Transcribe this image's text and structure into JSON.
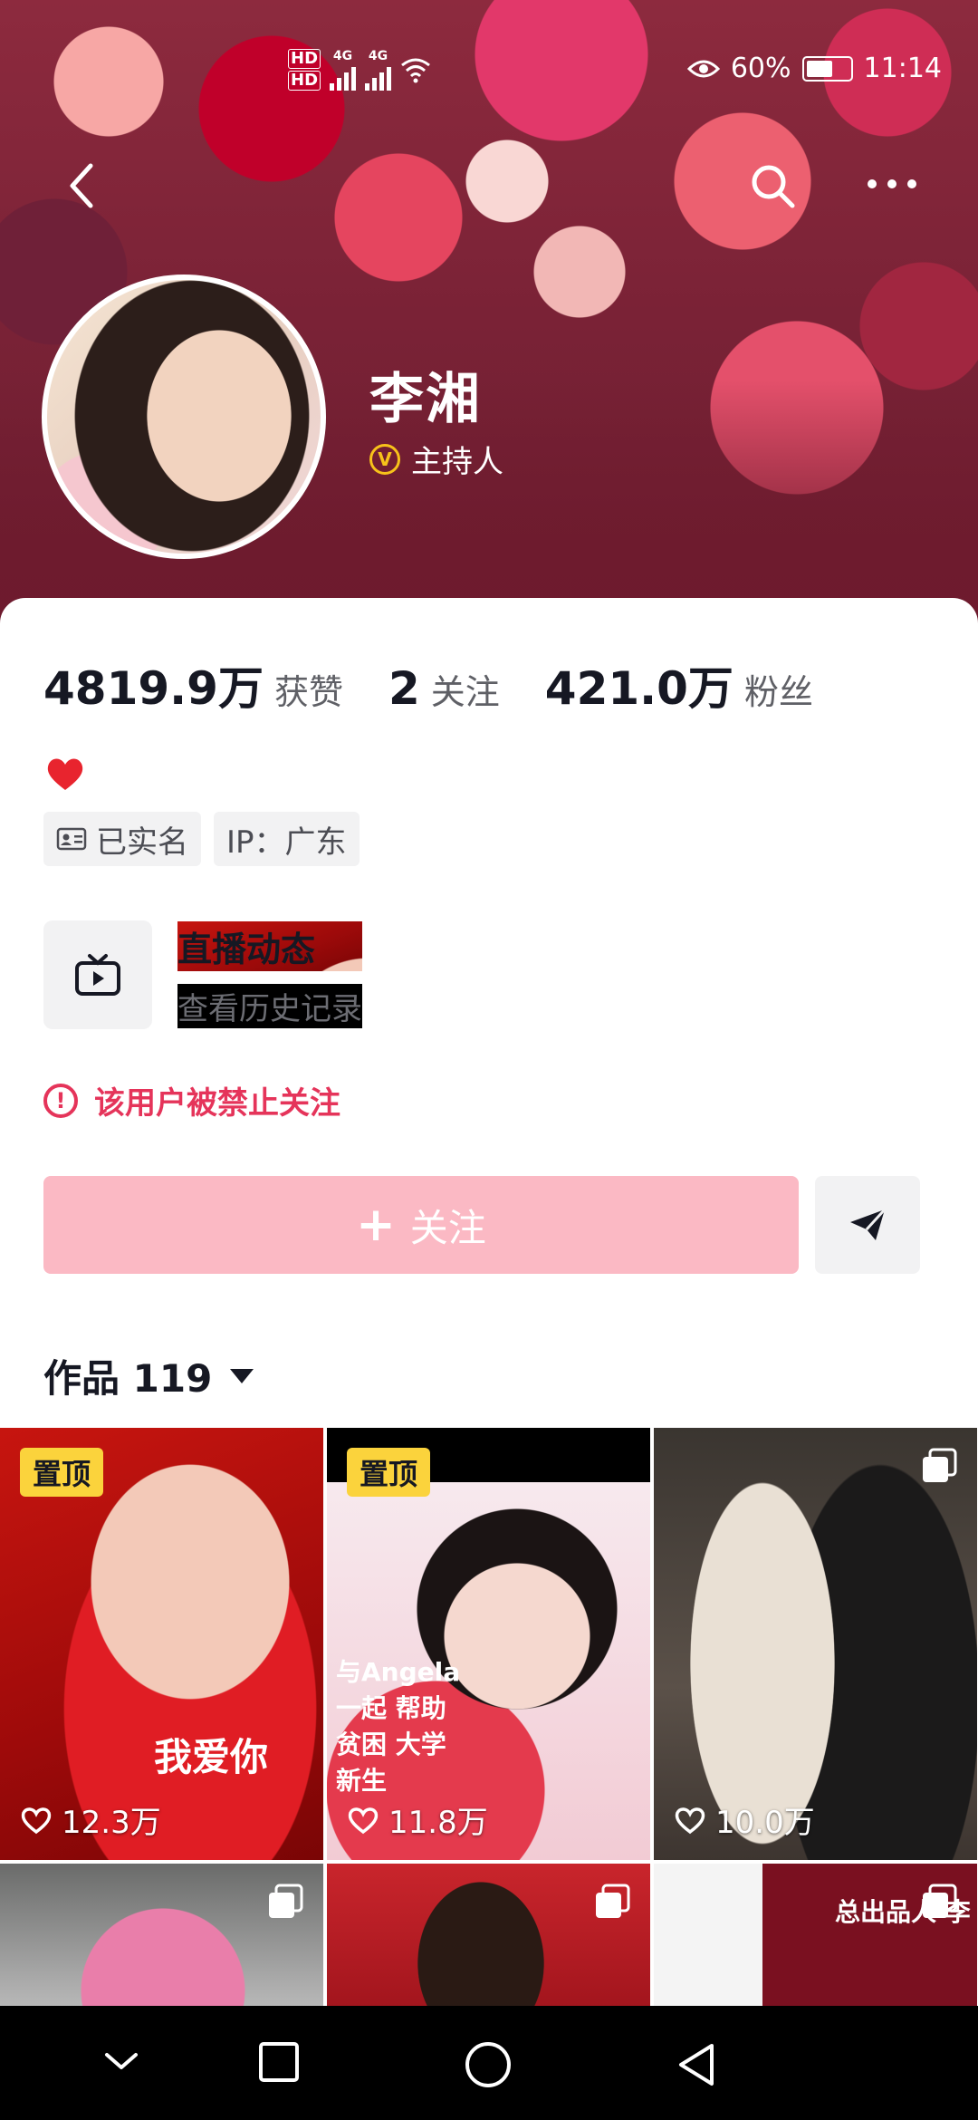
{
  "status_bar": {
    "hd1": "HD",
    "hd2": "HD",
    "net1": "4G",
    "net2": "4G",
    "battery": "60%",
    "time": "11:14"
  },
  "profile": {
    "name": "李湘",
    "verify_badge": "V",
    "verify_label": "主持人"
  },
  "stats": [
    {
      "value": "4819.9万",
      "label": "获赞"
    },
    {
      "value": "2",
      "label": "关注"
    },
    {
      "value": "421.0万",
      "label": "粉丝"
    }
  ],
  "tags": [
    {
      "label": "已实名",
      "icon": "id-card-icon"
    },
    {
      "label": "IP：广东"
    }
  ],
  "live": {
    "title": "直播动态",
    "subtitle": "查看历史记录"
  },
  "ban_notice": "该用户被禁止关注",
  "follow_button": {
    "plus": "+",
    "label": "关注"
  },
  "works": {
    "label": "作品 119"
  },
  "grid": [
    {
      "pinned": "置顶",
      "likes": "12.3万",
      "overlay": "我爱你"
    },
    {
      "pinned": "置顶",
      "likes": "11.8万",
      "overlay": "与Angela 一起 帮助贫困 大学新生"
    },
    {
      "likes": "10.0万"
    },
    {},
    {},
    {
      "overlay": "总出品人 李"
    }
  ],
  "colors": {
    "accent_red": "#e5345a",
    "follow_pink": "#fbb9c4",
    "pin_yellow": "#fbd33c",
    "verify_gold": "#f7c21a"
  }
}
